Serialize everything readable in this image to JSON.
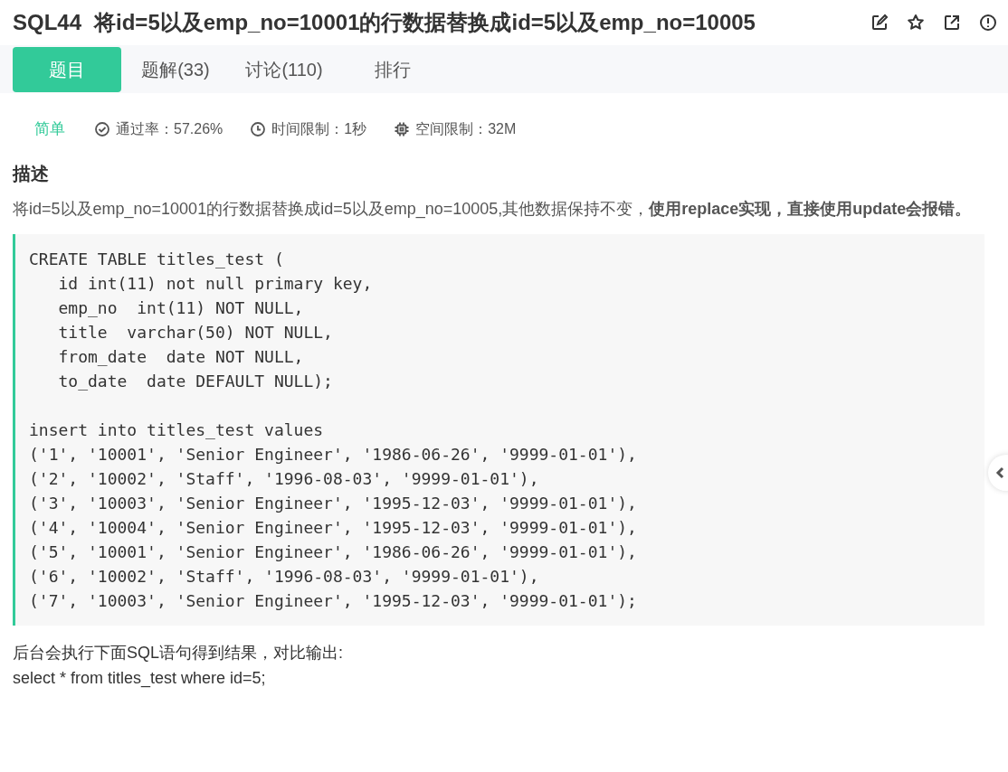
{
  "title": {
    "code": "SQL44",
    "text": "将id=5以及emp_no=10001的行数据替换成id=5以及emp_no=10005"
  },
  "tabs": [
    {
      "label": "题目",
      "selected": true
    },
    {
      "label": "题解(33)",
      "selected": false
    },
    {
      "label": "讨论(110)",
      "selected": false
    },
    {
      "label": "排行",
      "selected": false
    }
  ],
  "meta": {
    "difficulty": "简单",
    "items": [
      {
        "kind": "check",
        "text": "通过率：57.26%"
      },
      {
        "kind": "clock",
        "text": "时间限制：1秒"
      },
      {
        "kind": "chip",
        "text": "空间限制：32M"
      }
    ]
  },
  "description": {
    "heading": "描述",
    "text": "将id=5以及emp_no=10001的行数据替换成id=5以及emp_no=10005,其他数据保持不变，**使用replace实现，直接使用update会报错。**",
    "code": [
      [
        "CREATE TABLE titles_test (",
        "   id int(11) not null primary key,",
        "   emp_no  int(11) NOT NULL,",
        "   title  varchar(50) NOT NULL,",
        "   from_date  date NOT NULL,",
        "   to_date  date DEFAULT NULL);"
      ],
      [
        "insert into titles_test values",
        "('1', '10001', 'Senior Engineer', '1986-06-26', '9999-01-01'),",
        "('2', '10002', 'Staff', '1996-08-03', '9999-01-01'),",
        "('3', '10003', 'Senior Engineer', '1995-12-03', '9999-01-01'),",
        "('4', '10004', 'Senior Engineer', '1995-12-03', '9999-01-01'),",
        "('5', '10001', 'Senior Engineer', '1986-06-26', '9999-01-01'),",
        "('6', '10002', 'Staff', '1996-08-03', '9999-01-01'),",
        "('7', '10003', 'Senior Engineer', '1995-12-03', '9999-01-01');"
      ]
    ],
    "after": [
      "后台会执行下面SQL语句得到结果，对比输出:",
      "select * from titles_test where id=5;"
    ]
  }
}
